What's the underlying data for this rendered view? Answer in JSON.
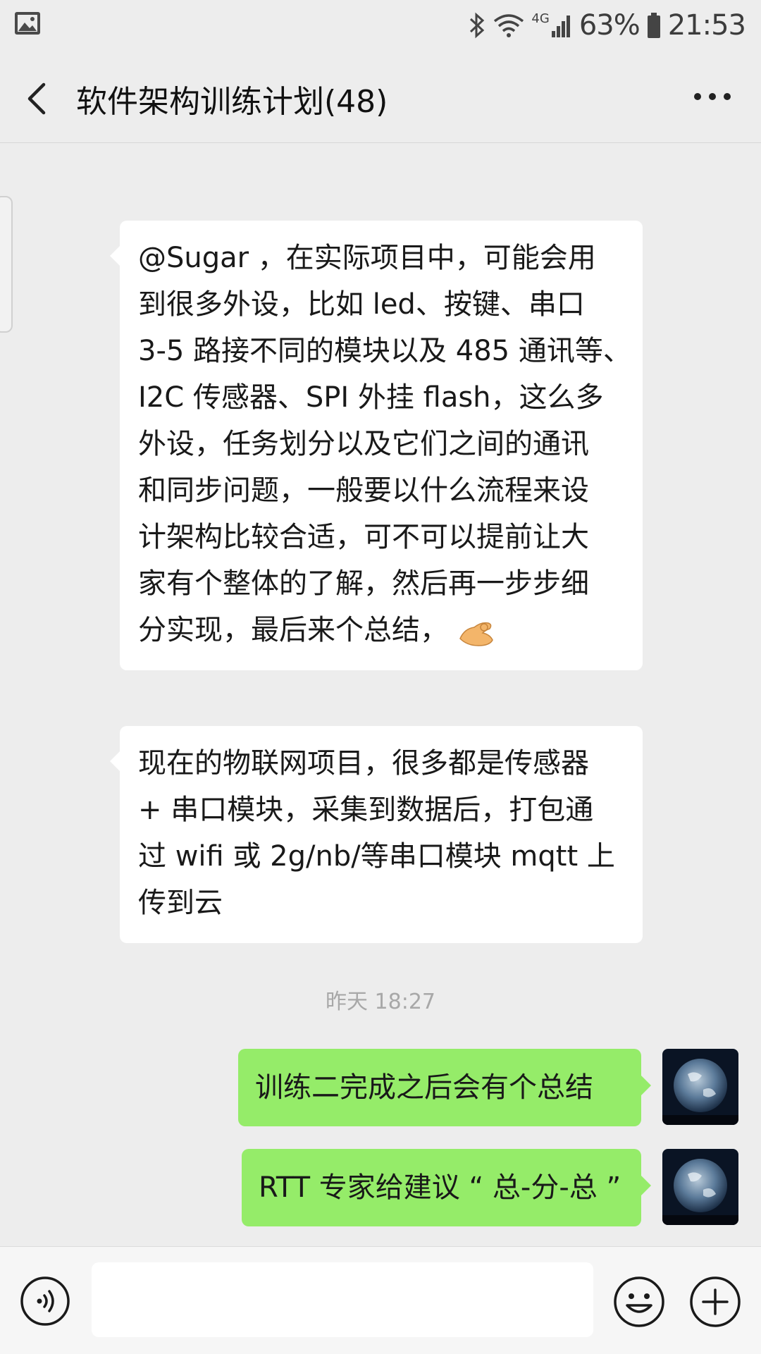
{
  "status_bar": {
    "network": "4G",
    "battery_percent": "63%",
    "time": "21:53"
  },
  "header": {
    "title": "软件架构训练计划(48)",
    "back_icon": "chevron-left-icon",
    "more_icon": "more-dots-icon"
  },
  "colors": {
    "background": "#ededed",
    "incoming_bubble": "#ffffff",
    "outgoing_bubble": "#95ec69",
    "timestamp_text": "#a8a8a8"
  },
  "messages": [
    {
      "direction": "incoming",
      "lines": [
        "@Sugar ，在实际项目中，可能会用",
        "到很多外设，比如 led、按键、串口",
        "3-5 路接不同的模块以及 485 通讯等、",
        "I2C 传感器、SPI 外挂 flash，这么多",
        "外设，任务划分以及它们之间的通讯",
        "和同步问题，一般要以什么流程来设",
        "计架构比较合适，可不可以提前让大",
        "家有个整体的了解，然后再一步步细",
        "分实现，最后来个总结，"
      ],
      "emoji": "ok-hand-emoji"
    },
    {
      "direction": "incoming",
      "lines": [
        "现在的物联网项目，很多都是传感器",
        "+ 串口模块，采集到数据后，打包通",
        "过 wifi 或 2g/nb/等串口模块 mqtt 上",
        "传到云"
      ]
    },
    {
      "direction": "timestamp",
      "text": "昨天 18:27"
    },
    {
      "direction": "outgoing",
      "text": "训练二完成之后会有个总结",
      "avatar": "earth-avatar"
    },
    {
      "direction": "outgoing",
      "text": "RTT 专家给建议 “ 总-分-总 ”",
      "avatar": "earth-avatar"
    }
  ],
  "input_bar": {
    "voice_icon": "voice-icon",
    "text_value": "",
    "emoji_icon": "smile-icon",
    "plus_icon": "plus-circle-icon"
  }
}
